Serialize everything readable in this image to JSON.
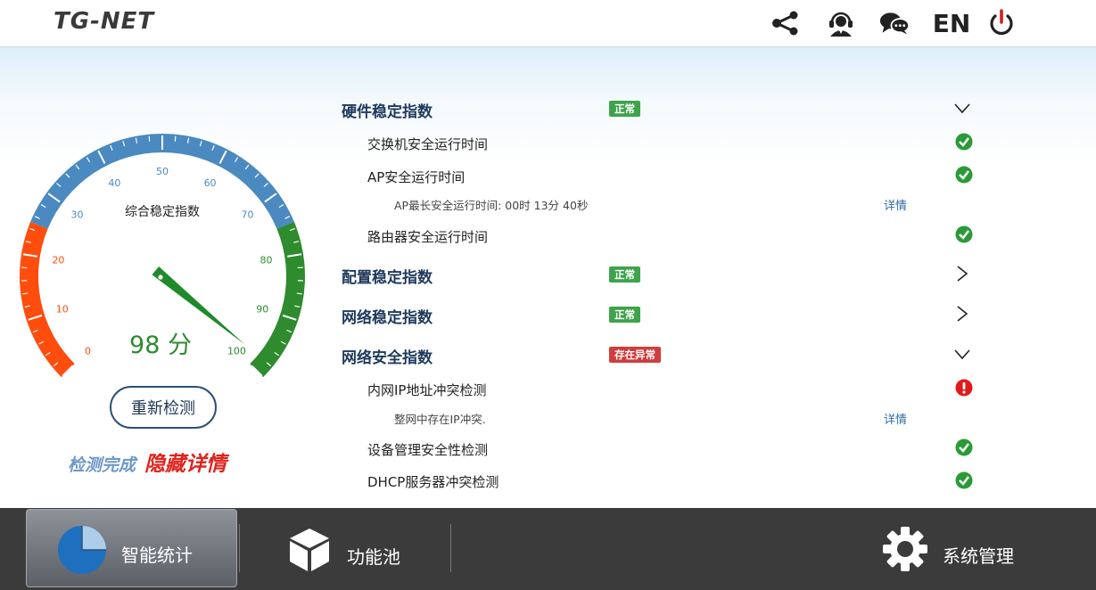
{
  "header": {
    "logo": "TG-NET",
    "language": "EN",
    "icons": [
      "share-icon",
      "customer-service-icon",
      "chat-icon",
      "power-icon"
    ]
  },
  "gauge": {
    "title": "综合稳定指数",
    "score": 98,
    "score_text": "98 分",
    "ticks": [
      "0",
      "10",
      "20",
      "30",
      "40",
      "50",
      "60",
      "70",
      "80",
      "90",
      "100"
    ],
    "colors": {
      "low": "#ff4d0d",
      "mid": "#4a8ac0",
      "high": "#2e8b2e"
    }
  },
  "actions": {
    "redetect": "重新检测",
    "status": "检测完成",
    "hide_details": "隐藏详情"
  },
  "categories": [
    {
      "title": "硬件稳定指数",
      "badge": "正常",
      "expanded": true,
      "items": [
        {
          "label": "交换机安全运行时间",
          "status": "ok"
        },
        {
          "label": "AP安全运行时间",
          "status": "ok",
          "detail": "AP最长安全运行时间: 00时 13分 40秒",
          "detail_link": "详情"
        },
        {
          "label": "路由器安全运行时间",
          "status": "ok"
        }
      ]
    },
    {
      "title": "配置稳定指数",
      "badge": "正常",
      "expanded": false,
      "items": []
    },
    {
      "title": "网络稳定指数",
      "badge": "正常",
      "expanded": false,
      "items": []
    },
    {
      "title": "网络安全指数",
      "badge": "存在异常",
      "expanded": true,
      "items": [
        {
          "label": "内网IP地址冲突检测",
          "status": "error",
          "detail": "整网中存在IP冲突.",
          "detail_link": "详情"
        },
        {
          "label": "设备管理安全性检测",
          "status": "ok"
        },
        {
          "label": "DHCP服务器冲突检测",
          "status": "ok"
        }
      ]
    }
  ],
  "footer": {
    "tabs": [
      {
        "label": "智能统计",
        "active": true
      },
      {
        "label": "功能池",
        "active": false
      },
      {
        "label": "系统管理",
        "active": false
      }
    ]
  }
}
